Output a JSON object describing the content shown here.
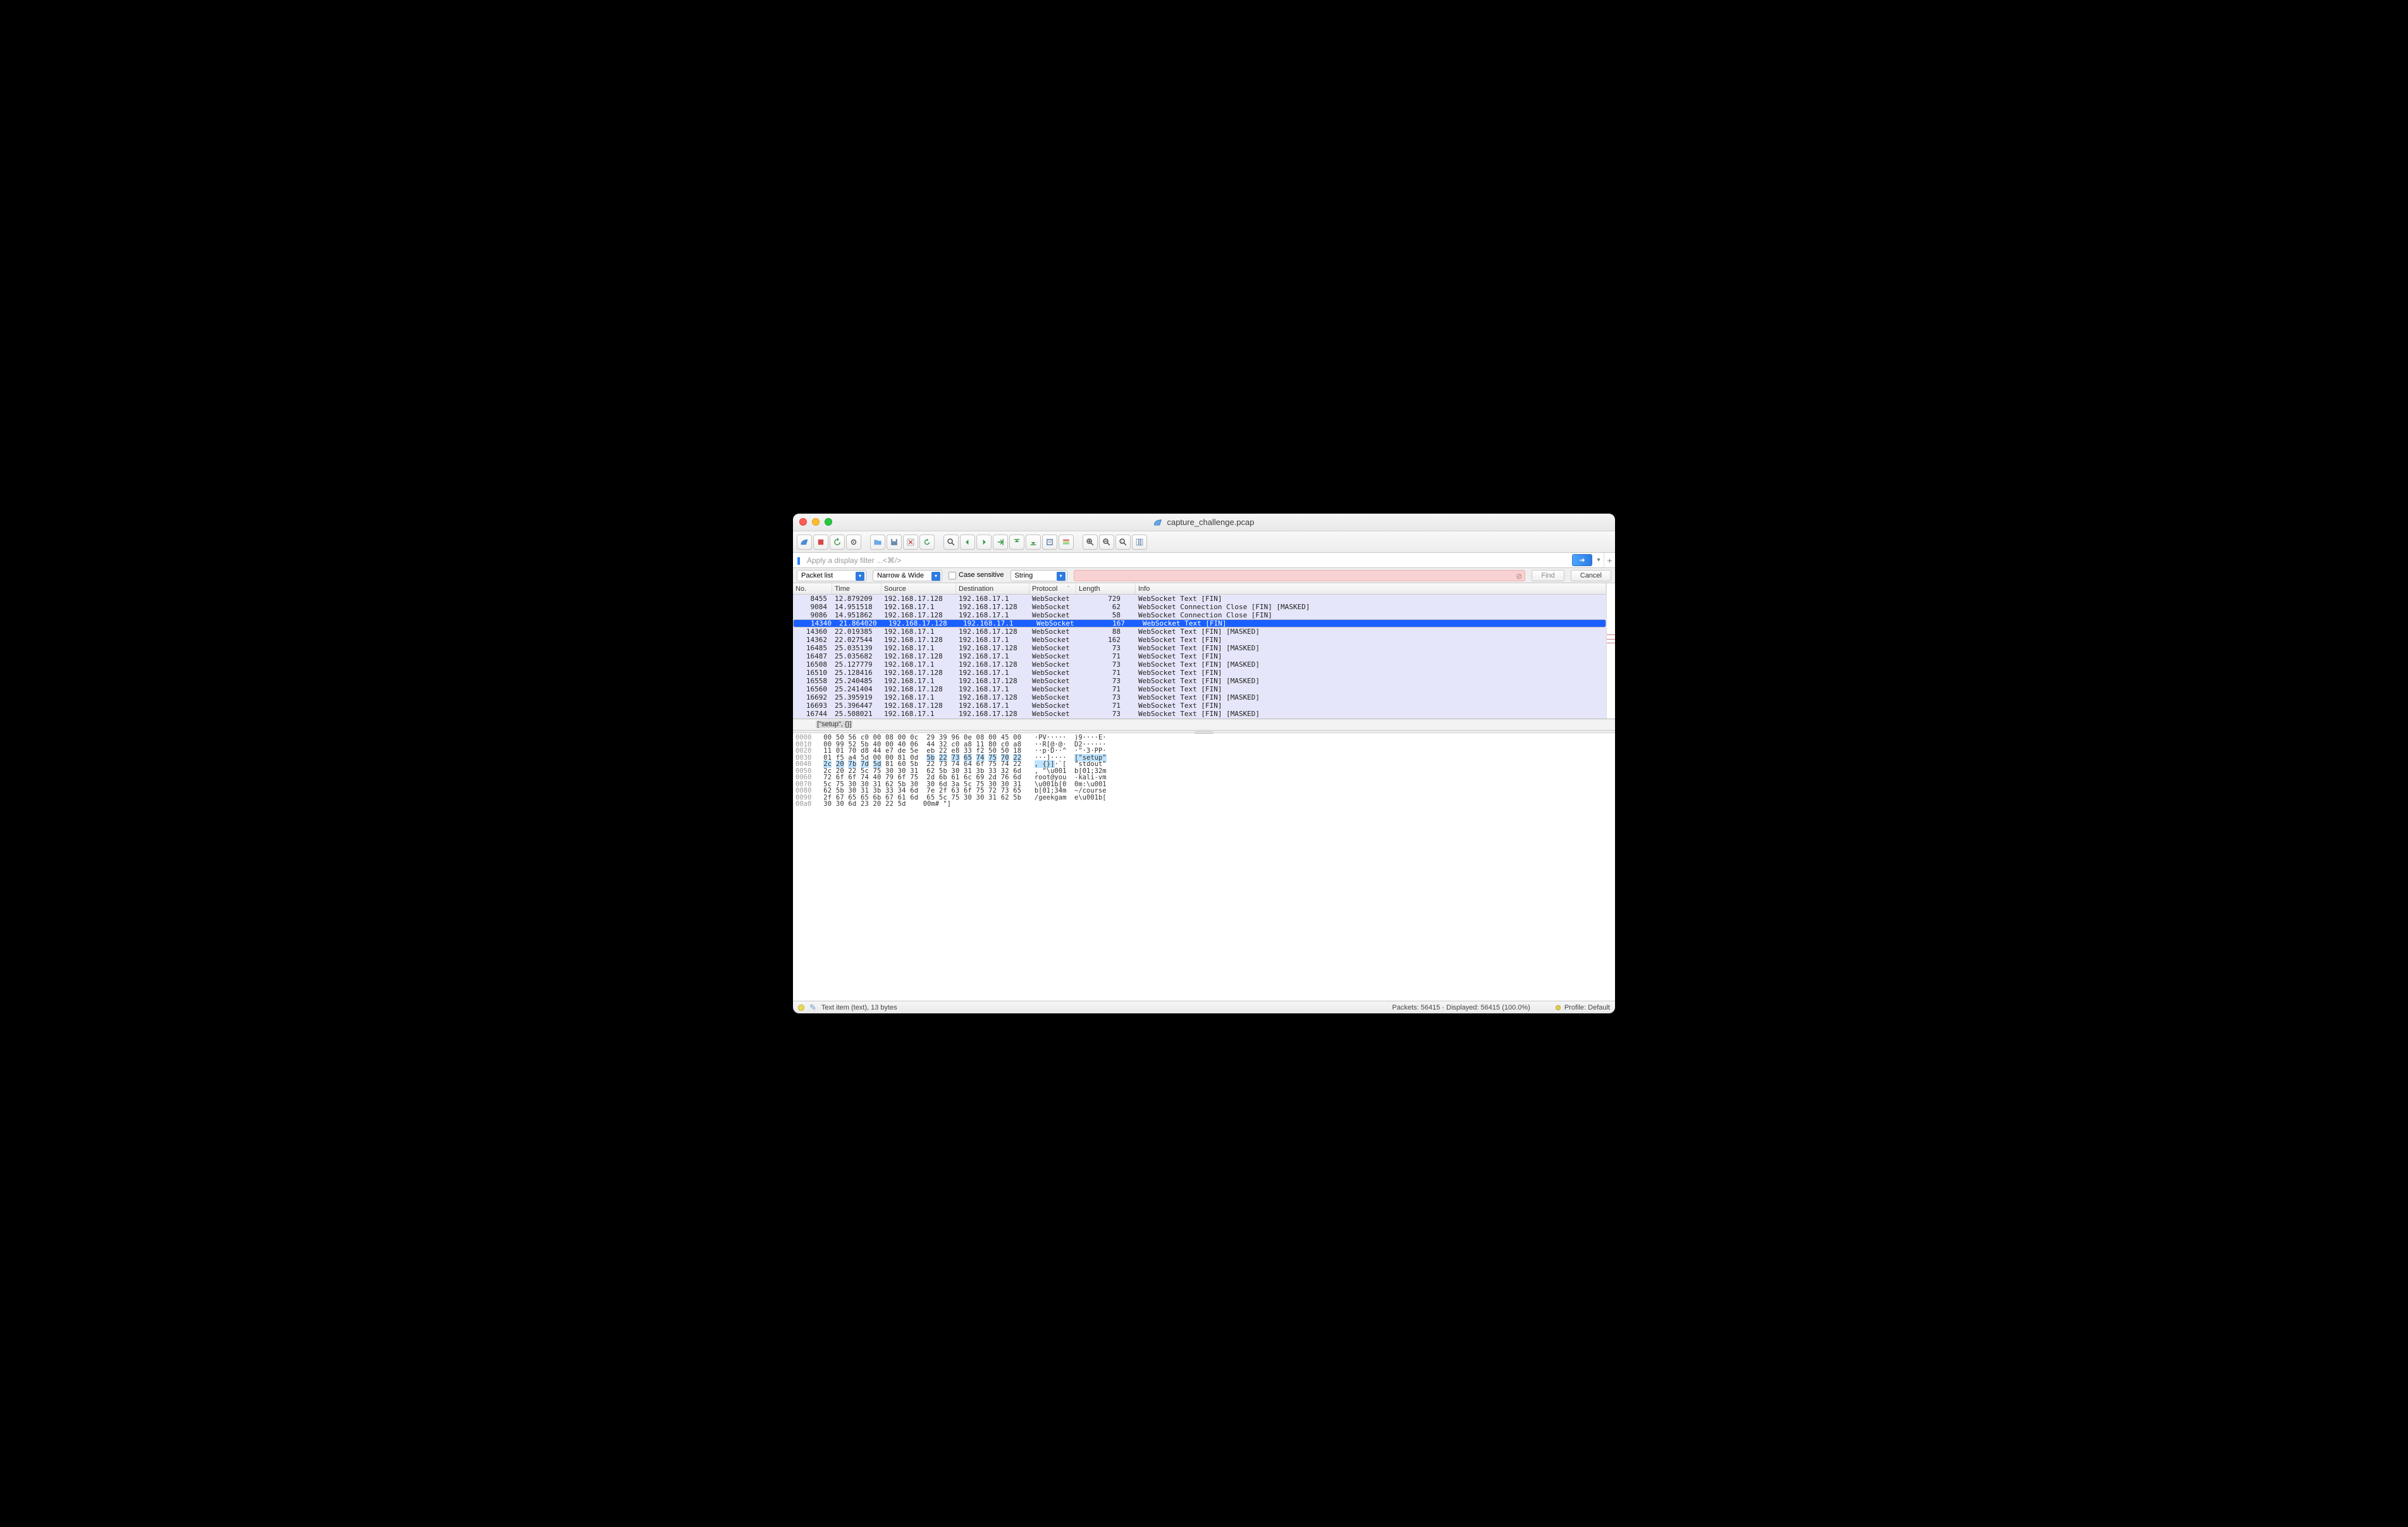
{
  "window": {
    "title": "capture_challenge.pcap"
  },
  "filter": {
    "placeholder": "Apply a display filter ...<⌘/>"
  },
  "findbar": {
    "scope": "Packet list",
    "width": "Narrow & Wide",
    "case_label": "Case sensitive",
    "type": "String",
    "find_label": "Find",
    "cancel_label": "Cancel"
  },
  "columns": {
    "no": "No.",
    "time": "Time",
    "src": "Source",
    "dst": "Destination",
    "proto": "Protocol",
    "len": "Length",
    "info": "Info"
  },
  "selected_index": 3,
  "packets": [
    {
      "no": "8455",
      "time": "12.879209",
      "src": "192.168.17.128",
      "dst": "192.168.17.1",
      "proto": "WebSocket",
      "len": "729",
      "info": "WebSocket Text [FIN]"
    },
    {
      "no": "9084",
      "time": "14.951518",
      "src": "192.168.17.1",
      "dst": "192.168.17.128",
      "proto": "WebSocket",
      "len": "62",
      "info": "WebSocket Connection Close [FIN] [MASKED]"
    },
    {
      "no": "9086",
      "time": "14.951862",
      "src": "192.168.17.128",
      "dst": "192.168.17.1",
      "proto": "WebSocket",
      "len": "58",
      "info": "WebSocket Connection Close [FIN]"
    },
    {
      "no": "14340",
      "time": "21.864020",
      "src": "192.168.17.128",
      "dst": "192.168.17.1",
      "proto": "WebSocket",
      "len": "167",
      "info": "WebSocket Text [FIN]"
    },
    {
      "no": "14360",
      "time": "22.019385",
      "src": "192.168.17.1",
      "dst": "192.168.17.128",
      "proto": "WebSocket",
      "len": "88",
      "info": "WebSocket Text [FIN] [MASKED]"
    },
    {
      "no": "14362",
      "time": "22.027544",
      "src": "192.168.17.128",
      "dst": "192.168.17.1",
      "proto": "WebSocket",
      "len": "162",
      "info": "WebSocket Text [FIN]"
    },
    {
      "no": "16485",
      "time": "25.035139",
      "src": "192.168.17.1",
      "dst": "192.168.17.128",
      "proto": "WebSocket",
      "len": "73",
      "info": "WebSocket Text [FIN] [MASKED]"
    },
    {
      "no": "16487",
      "time": "25.035682",
      "src": "192.168.17.128",
      "dst": "192.168.17.1",
      "proto": "WebSocket",
      "len": "71",
      "info": "WebSocket Text [FIN]"
    },
    {
      "no": "16508",
      "time": "25.127779",
      "src": "192.168.17.1",
      "dst": "192.168.17.128",
      "proto": "WebSocket",
      "len": "73",
      "info": "WebSocket Text [FIN] [MASKED]"
    },
    {
      "no": "16510",
      "time": "25.128416",
      "src": "192.168.17.128",
      "dst": "192.168.17.1",
      "proto": "WebSocket",
      "len": "71",
      "info": "WebSocket Text [FIN]"
    },
    {
      "no": "16558",
      "time": "25.240485",
      "src": "192.168.17.1",
      "dst": "192.168.17.128",
      "proto": "WebSocket",
      "len": "73",
      "info": "WebSocket Text [FIN] [MASKED]"
    },
    {
      "no": "16560",
      "time": "25.241404",
      "src": "192.168.17.128",
      "dst": "192.168.17.1",
      "proto": "WebSocket",
      "len": "71",
      "info": "WebSocket Text [FIN]"
    },
    {
      "no": "16692",
      "time": "25.395919",
      "src": "192.168.17.1",
      "dst": "192.168.17.128",
      "proto": "WebSocket",
      "len": "73",
      "info": "WebSocket Text [FIN] [MASKED]"
    },
    {
      "no": "16693",
      "time": "25.396447",
      "src": "192.168.17.128",
      "dst": "192.168.17.1",
      "proto": "WebSocket",
      "len": "71",
      "info": "WebSocket Text [FIN]"
    },
    {
      "no": "16744",
      "time": "25.508021",
      "src": "192.168.17.1",
      "dst": "192.168.17.128",
      "proto": "WebSocket",
      "len": "73",
      "info": "WebSocket Text [FIN] [MASKED]"
    },
    {
      "no": "16745",
      "time": "25.508550",
      "src": "192.168.17.128",
      "dst": "192.168.17.1",
      "proto": "WebSocket",
      "len": "71",
      "info": "WebSocket Text [FIN]"
    }
  ],
  "tree": {
    "label": "[\"setup\", {}]"
  },
  "hex": [
    {
      "off": "0000",
      "hex": "00 50 56 c0 00 08 00 0c  29 39 96 0e 08 00 45 00",
      "ascii": "·PV·····  )9····E·",
      "hl": null
    },
    {
      "off": "0010",
      "hex": "00 99 52 5b 40 00 40 06  44 32 c0 a8 11 80 c0 a8",
      "ascii": "··R[@·@·  D2······",
      "hl": null
    },
    {
      "off": "0020",
      "hex": "11 01 70 d8 44 e7 de 5e  eb 22 e8 33 f2 50 50 18",
      "ascii": "··p·D··^  ·\"·3·PP·",
      "hl": null
    },
    {
      "off": "0030",
      "hex": "01 f5 a4 5d 00 00 81 0d  5b 22 73 65 74 75 70 22",
      "ascii": "···]····  [\"setup\"",
      "hl": {
        "hexStart": 8,
        "hexEnd": 16,
        "asciiStart": 10,
        "asciiEnd": 18
      }
    },
    {
      "off": "0040",
      "hex": "2c 20 7b 7d 5d 81 60 5b  22 73 74 64 6f 75 74 22",
      "ascii": ", {}]·`[  \"stdout\"",
      "hl": {
        "hexStart": 0,
        "hexEnd": 5,
        "asciiStart": 0,
        "asciiEnd": 5
      }
    },
    {
      "off": "0050",
      "hex": "2c 20 22 5c 75 30 30 31  62 5b 30 31 3b 33 32 6d",
      "ascii": ", \"\\u001  b[01;32m",
      "hl": null
    },
    {
      "off": "0060",
      "hex": "72 6f 6f 74 40 79 6f 75  2d 6b 61 6c 69 2d 76 6d",
      "ascii": "root@you  -kali-vm",
      "hl": null
    },
    {
      "off": "0070",
      "hex": "5c 75 30 30 31 62 5b 30  30 6d 3a 5c 75 30 30 31",
      "ascii": "\\u001b[0  0m:\\u001",
      "hl": null
    },
    {
      "off": "0080",
      "hex": "62 5b 30 31 3b 33 34 6d  7e 2f 63 6f 75 72 73 65",
      "ascii": "b[01;34m  ~/course",
      "hl": null
    },
    {
      "off": "0090",
      "hex": "2f 67 65 65 6b 67 61 6d  65 5c 75 30 30 31 62 5b",
      "ascii": "/geekgam  e\\u001b[",
      "hl": null
    },
    {
      "off": "00a0",
      "hex": "30 30 6d 23 20 22 5d",
      "ascii": "00m# \"]",
      "hl": null
    }
  ],
  "status": {
    "item": "Text item (text), 13 bytes",
    "counts": "Packets: 56415 · Displayed: 56415 (100.0%)",
    "profile": "Profile: Default"
  }
}
